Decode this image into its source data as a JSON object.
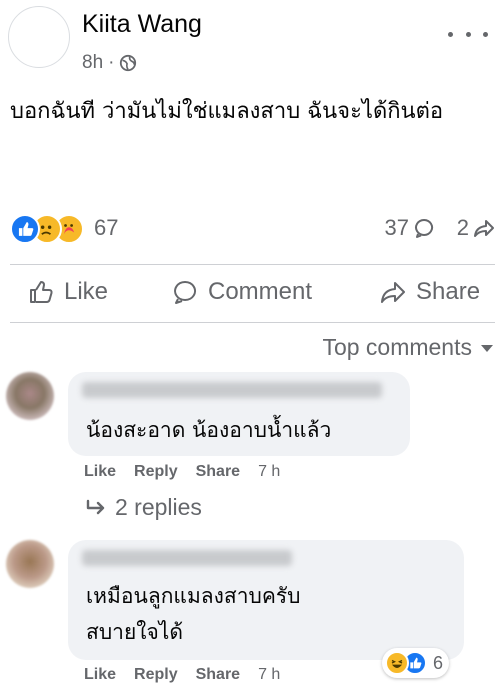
{
  "post": {
    "author": "Kiita Wang",
    "time": "8h",
    "separator": "·",
    "text": "บอกฉันที ว่ามันไม่ใช่แมลงสาบ ฉันจะได้กินต่อ"
  },
  "stats": {
    "reaction_count": "67",
    "comment_count": "37",
    "share_count": "2",
    "reaction_icons": [
      "like-icon",
      "sad-icon",
      "care-icon"
    ]
  },
  "actions": {
    "like": "Like",
    "comment": "Comment",
    "share": "Share"
  },
  "sort": {
    "label": "Top comments"
  },
  "comments": [
    {
      "text": "น้องสะอาด น้องอาบน้ำแล้ว",
      "like": "Like",
      "reply": "Reply",
      "share": "Share",
      "time": "7 h",
      "replies_label": "2 replies"
    },
    {
      "text_line1": "เหมือนลูกแมลงสาบครับ",
      "text_line2": "สบายใจได้",
      "like": "Like",
      "reply": "Reply",
      "share": "Share",
      "time": "7 h",
      "reaction_count": "6",
      "reaction_icons": [
        "haha-icon",
        "like-icon"
      ]
    }
  ],
  "colors": {
    "accent": "#1877f2",
    "secondary_text": "#65676b",
    "bubble": "#f0f2f5"
  }
}
